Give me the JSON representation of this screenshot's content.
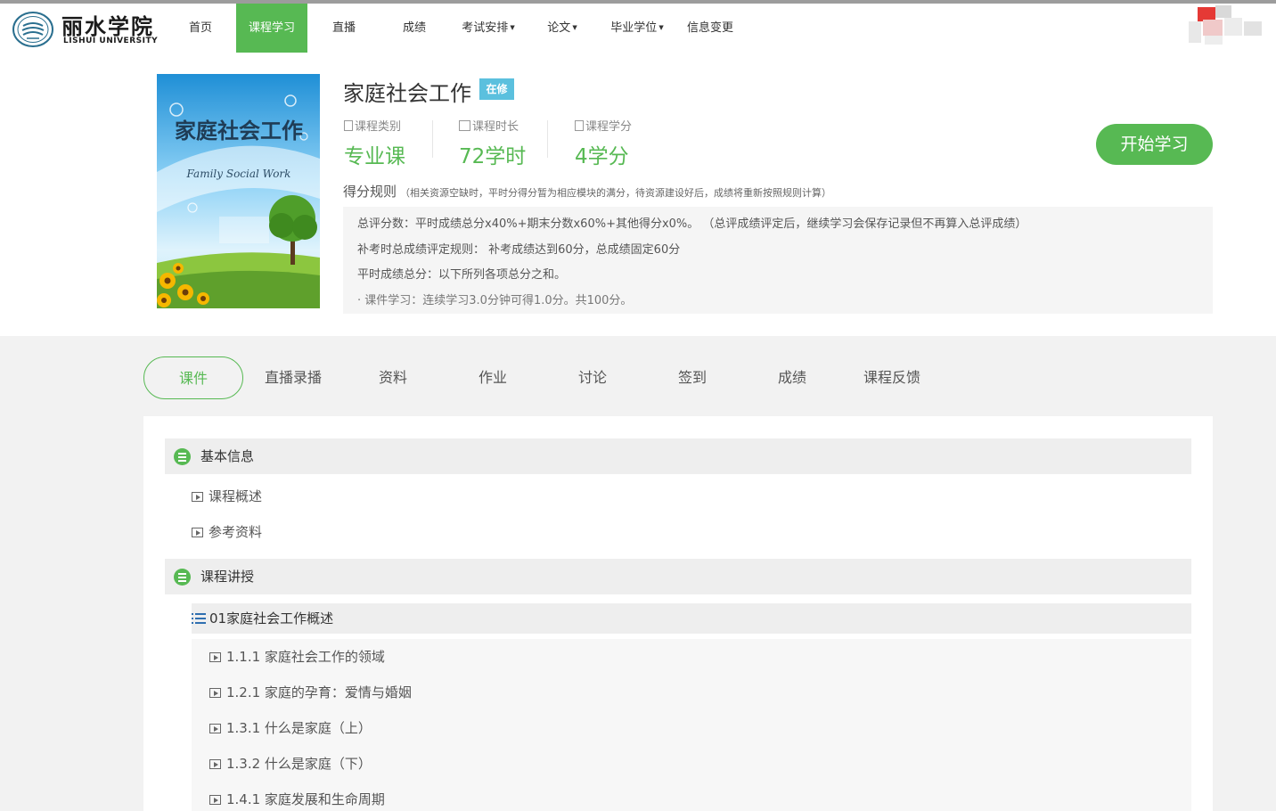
{
  "header": {
    "logo_cn": "丽水学院",
    "logo_en": "LISHUI UNIVERSITY",
    "nav": [
      {
        "label": "首页"
      },
      {
        "label": "课程学习",
        "active": true
      },
      {
        "label": "直播"
      },
      {
        "label": "成绩"
      },
      {
        "label": "考试安排",
        "dropdown": true
      },
      {
        "label": "论文",
        "dropdown": true
      },
      {
        "label": "毕业学位",
        "dropdown": true
      },
      {
        "label": "信息变更"
      }
    ]
  },
  "course": {
    "title": "家庭社会工作",
    "status_badge": "在修",
    "cover_title": "家庭社会工作",
    "cover_subtitle": "Family Social Work",
    "stats": [
      {
        "label": "课程类别",
        "value": "专业课"
      },
      {
        "label": "课程时长",
        "value": "72学时"
      },
      {
        "label": "课程学分",
        "value": "4学分"
      }
    ],
    "start_button": "开始学习"
  },
  "rules": {
    "title": "得分规则",
    "note": "（相关资源空缺时，平时分得分暂为相应模块的满分，待资源建设好后，成绩将重新按照规则计算）",
    "lines": [
      "总评分数：平时成绩总分x40%+期末分数x60%+其他得分x0%。 （总评成绩评定后，继续学习会保存记录但不再算入总评成绩）",
      "补考时总成绩评定规则： 补考成绩达到60分，总成绩固定60分",
      "平时成绩总分：以下所列各项总分之和。",
      "· 课件学习：连续学习3.0分钟可得1.0分。共100分。"
    ]
  },
  "tabs": [
    {
      "label": "课件",
      "active": true
    },
    {
      "label": "直播录播"
    },
    {
      "label": "资料"
    },
    {
      "label": "作业"
    },
    {
      "label": "讨论"
    },
    {
      "label": "签到"
    },
    {
      "label": "成绩"
    },
    {
      "label": "课程反馈"
    }
  ],
  "courseware": {
    "sections": [
      {
        "title": "基本信息",
        "items": [
          "课程概述",
          "参考资料"
        ]
      },
      {
        "title": "课程讲授"
      }
    ],
    "chapter": "01家庭社会工作概述",
    "lessons": [
      "1.1.1 家庭社会工作的领域",
      "1.2.1 家庭的孕育：爱情与婚姻",
      "1.3.1 什么是家庭（上）",
      "1.3.2 什么是家庭（下）",
      "1.4.1 家庭发展和生命周期"
    ]
  },
  "colors": {
    "accent": "#57b953",
    "badge": "#5bc0de"
  }
}
